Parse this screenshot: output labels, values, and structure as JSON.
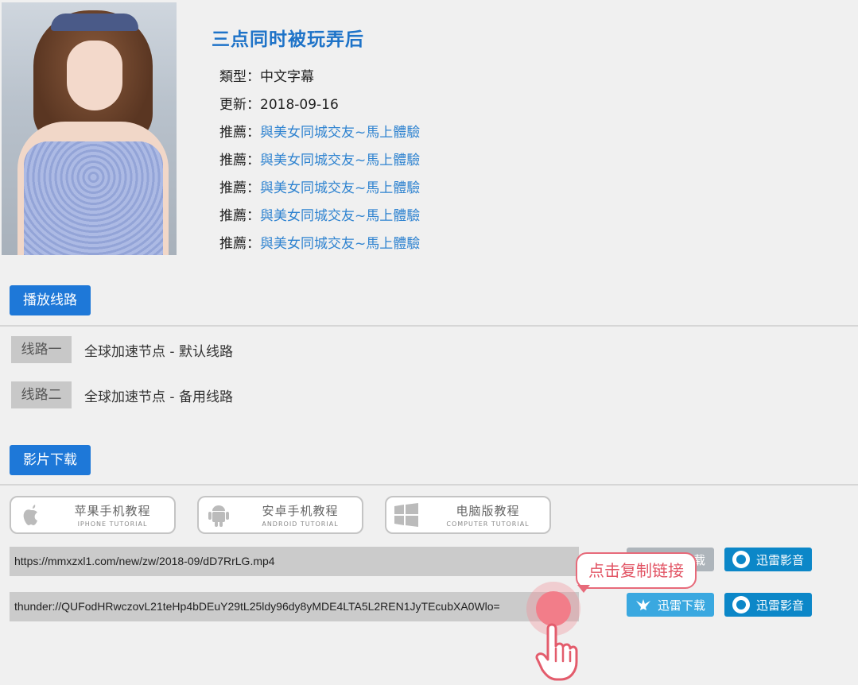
{
  "movie": {
    "title": "三点同时被玩弄后",
    "type_label": "類型：",
    "type_value": "中文字幕",
    "update_label": "更新：",
    "update_value": "2018-09-16",
    "recommend_label": "推薦：",
    "recommend_link": "與美女同城交友~馬上體驗"
  },
  "sections": {
    "play": "播放线路",
    "download": "影片下载"
  },
  "lines": [
    {
      "tag": "线路一",
      "desc": "全球加速节点 - 默认线路"
    },
    {
      "tag": "线路二",
      "desc": "全球加速节点 - 备用线路"
    }
  ],
  "tutorials": [
    {
      "icon": "apple-icon",
      "title": "苹果手机教程",
      "subtitle": "IPHONE TUTORIAL"
    },
    {
      "icon": "android-icon",
      "title": "安卓手机教程",
      "subtitle": "ANDROID TUTORIAL"
    },
    {
      "icon": "windows-icon",
      "title": "电脑版教程",
      "subtitle": "COMPUTER TUTORIAL"
    }
  ],
  "downloads": {
    "mp4_url": "https://mmxzxl1.com/new/zw/2018-09/dD7RrLG.mp4",
    "thunder_url": "thunder://QUFodHRwczovL21teHp4bDEuY29tL25ldy96dy8yMDE4LTA5L2REN1JyTEcubXA0Wlo=",
    "xunlei_label": "迅雷下载",
    "yingyin_label": "迅雷影音"
  },
  "hint": {
    "copy_text": "点击复制链接"
  },
  "colors": {
    "accent": "#1e78d8",
    "title": "#1e73c8",
    "link": "#2f83d0",
    "hint": "#e25464"
  }
}
